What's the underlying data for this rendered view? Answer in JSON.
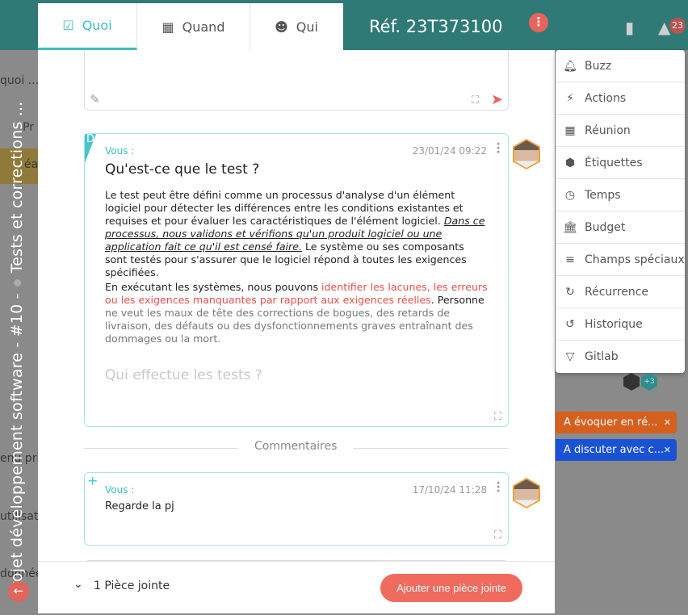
{
  "background": {
    "snippets": [
      "quoi ...",
      "Pr",
      "éa",
      "enu prin",
      "utilisate",
      "donnée"
    ],
    "breadcrumb_vertical": {
      "project": "Projet développement software - #10 -",
      "task": "Tests et corrections ..."
    },
    "notification_count": "23",
    "tags": [
      {
        "label": "A évoquer en ré...",
        "color": "#ff6a1a"
      },
      {
        "label": "A discuter avec c...",
        "color": "#1a5cff"
      }
    ],
    "avatar_extra": "+3"
  },
  "modal": {
    "tabs": [
      {
        "label": "Quoi",
        "icon": "clipboard-check-icon",
        "active": true
      },
      {
        "label": "Quand",
        "icon": "calendar-icon"
      },
      {
        "label": "Qui",
        "icon": "account-circle-icon"
      }
    ],
    "reference": "Réf. 23T373100",
    "description": {
      "corner_letter": "D",
      "author": "Vous :",
      "date": "23/01/24 09:22",
      "title": "Qu'est-ce que le test ?",
      "p1_a": "Le test peut être défini comme un processus d'analyse d'un élément logiciel pour détecter les différences entre les conditions existantes et requises et pour évaluer les caractéristiques de l'élément logiciel. ",
      "p1_em": "Dans ce processus, nous validons et vérifions qu'un produit logiciel ou une application fait ce qu'il est censé faire.",
      "p1_b": " Le système ou ses composants sont testés pour s'assurer que le logiciel répond à toutes les exigences spécifiées.",
      "p2_a": "En exécutant les systèmes, nous pouvons ",
      "p2_red": "identifier les lacunes, les erreurs ou les exigences manquantes par rapport aux exigences réelles",
      "p2_b": ". Personne ",
      "p2_c": "ne veut les maux de tête des corrections de bogues, des retards de livraison, des défauts ou des dysfonctionnements graves entraînant des dommages ou la mort.",
      "subtitle": "Qui effectue les tests ?"
    },
    "comments_label": "Commentaires",
    "comment": {
      "corner_icon": "+",
      "author": "Vous :",
      "date": "17/10/24 11:28",
      "text": "Regarde la pj"
    },
    "footer": {
      "attachments": "1 Pièce jointe",
      "add_button": "Ajouter une pièce jointe"
    }
  },
  "menu": [
    {
      "label": "Buzz",
      "icon": "bell-icon"
    },
    {
      "label": "Actions",
      "icon": "lightning-icon"
    },
    {
      "label": "Réunion",
      "icon": "calendar-icon"
    },
    {
      "label": "Étiquettes",
      "icon": "tag-icon"
    },
    {
      "label": "Temps",
      "icon": "clock-icon"
    },
    {
      "label": "Budget",
      "icon": "bank-icon"
    },
    {
      "label": "Champs spéciaux",
      "icon": "list-icon"
    },
    {
      "label": "Récurrence",
      "icon": "sync-icon"
    },
    {
      "label": "Historique",
      "icon": "history-icon"
    },
    {
      "label": "Gitlab",
      "icon": "gitlab-icon"
    }
  ]
}
